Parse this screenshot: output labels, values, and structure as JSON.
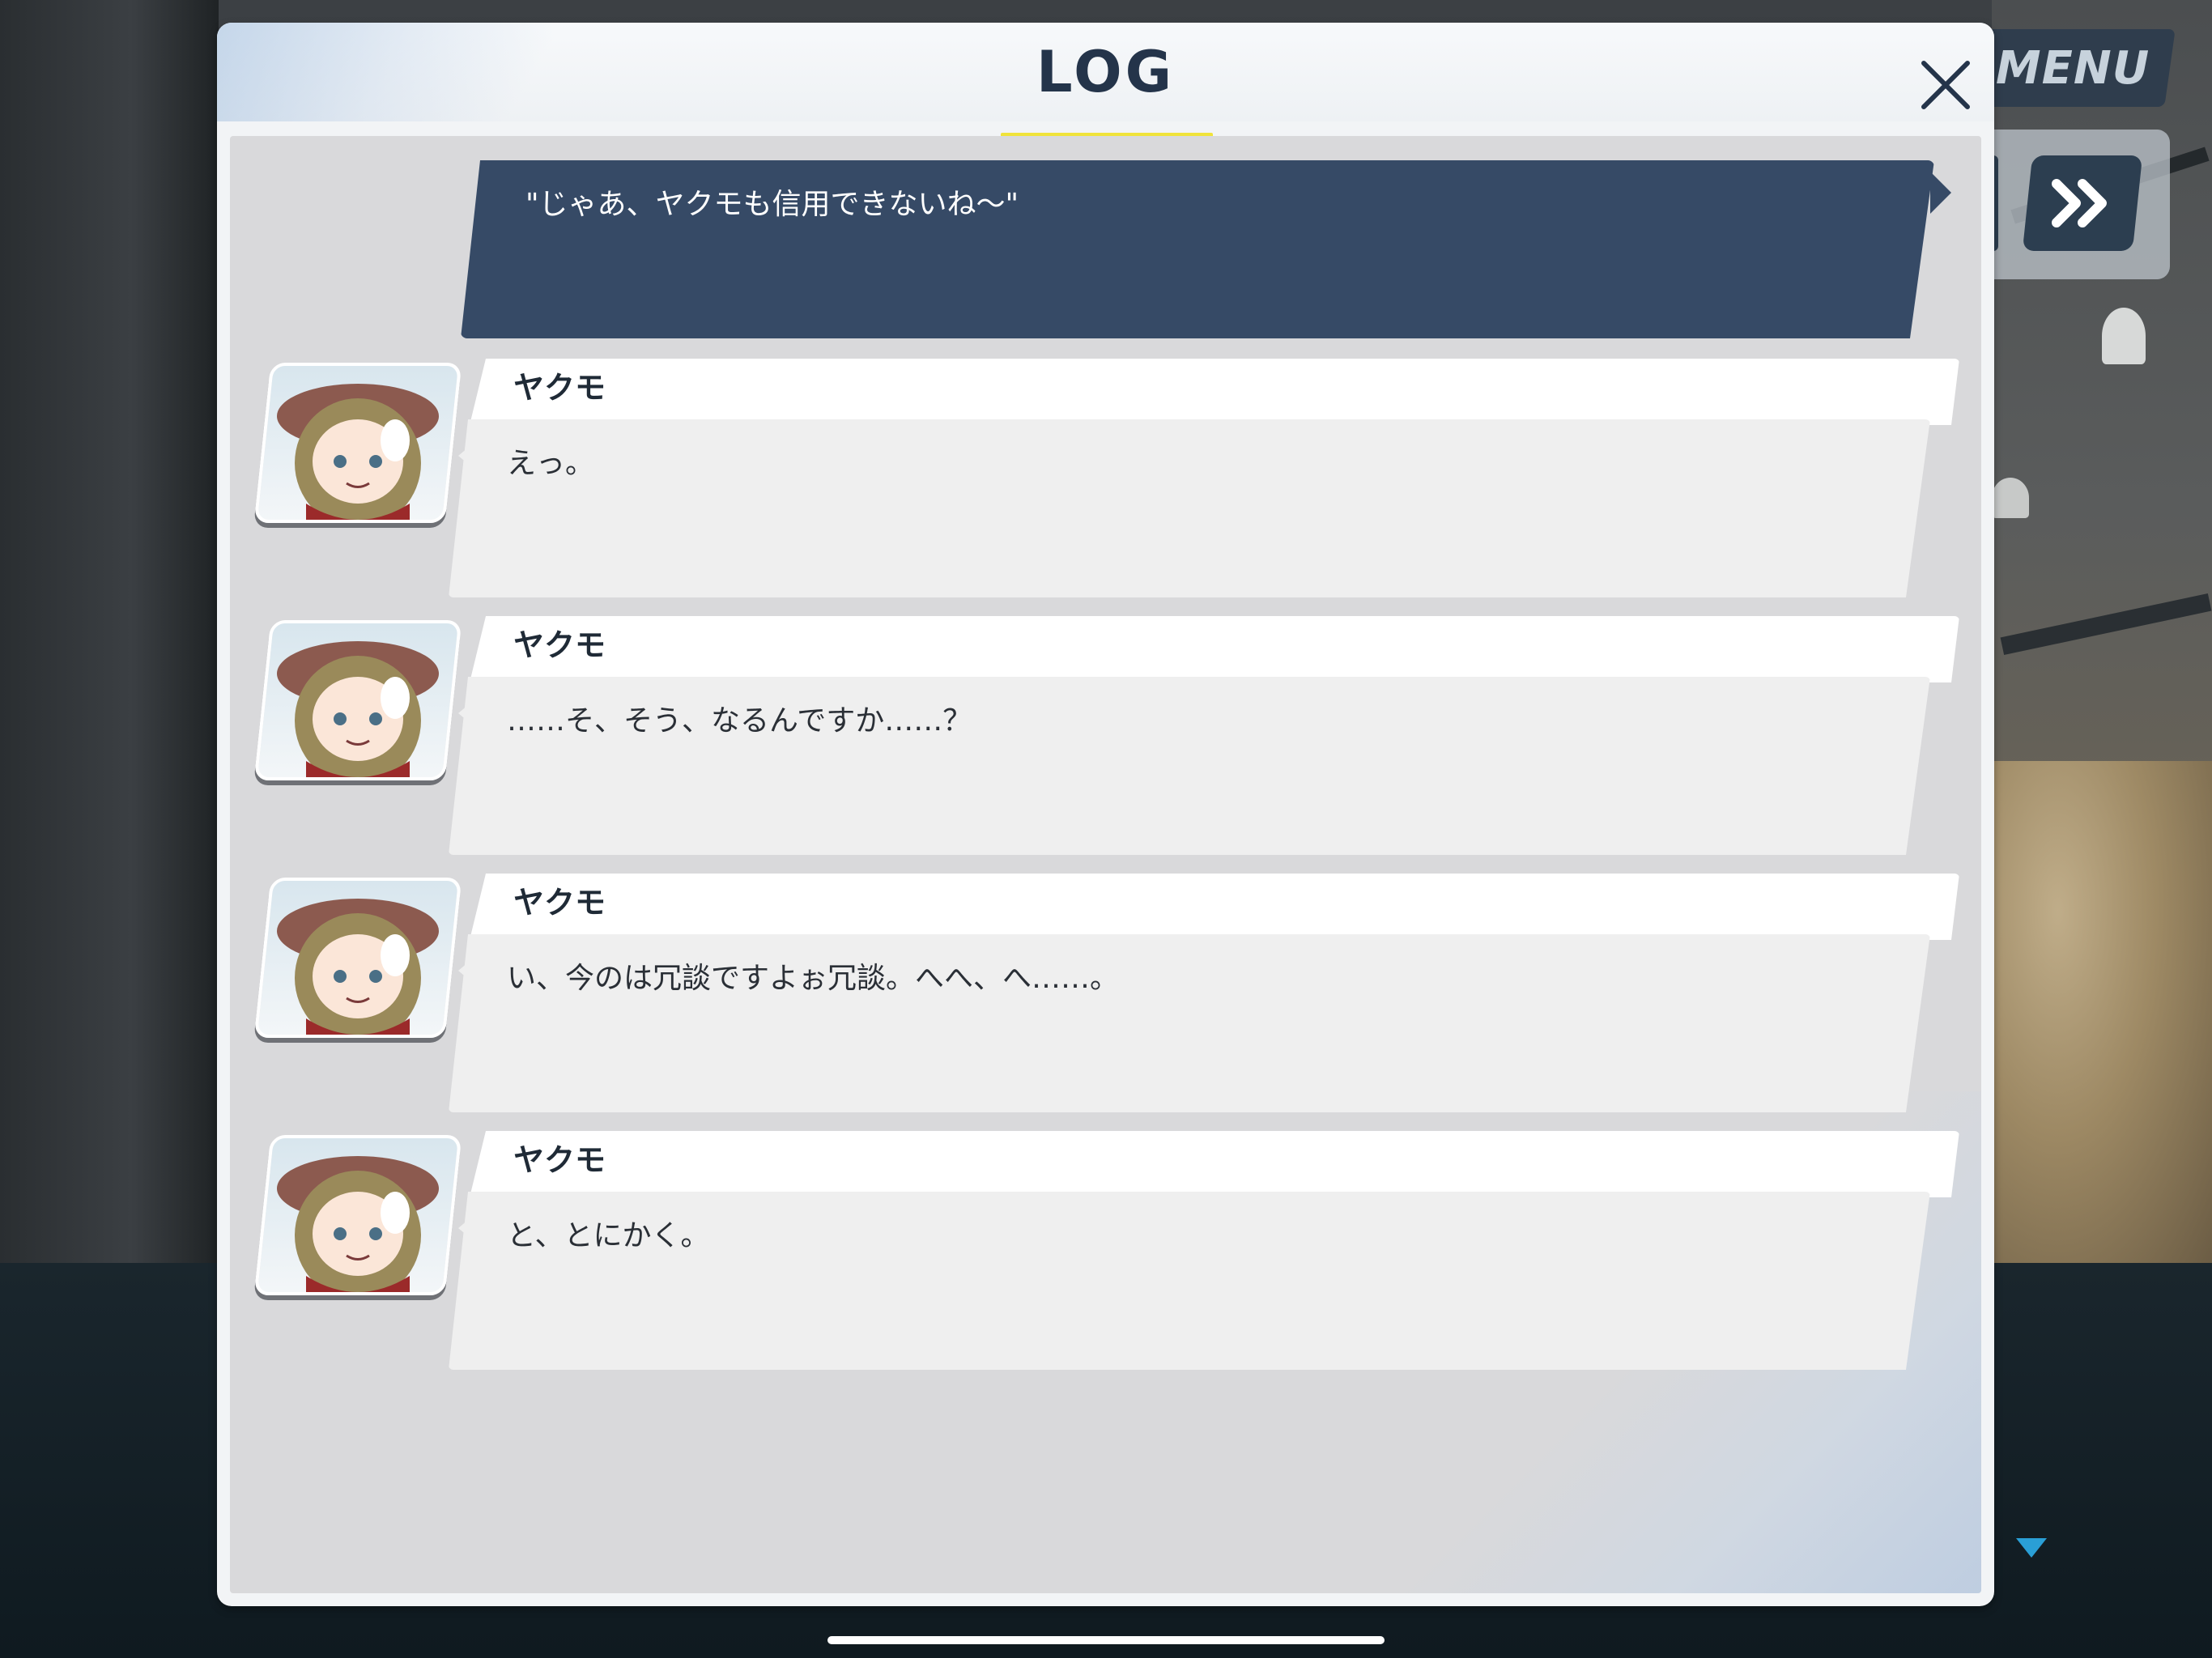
{
  "hud": {
    "menu_label": "MENU"
  },
  "log": {
    "title": "LOG",
    "narration": "\"じゃあ、ヤクモも信用できないね～\"",
    "entries": [
      {
        "speaker": "ヤクモ",
        "text": "えっ。"
      },
      {
        "speaker": "ヤクモ",
        "text": "……そ、そう、なるんですか……？"
      },
      {
        "speaker": "ヤクモ",
        "text": "い、今のは冗談ですよぉ冗談。へへ、へ……。"
      },
      {
        "speaker": "ヤクモ",
        "text": "と、とにかく。"
      }
    ]
  },
  "colors": {
    "panel_bg": "#f2f4f6",
    "body_bg": "#d9d9db",
    "narration_bg": "#364a66",
    "title_underline": "#f0e33a",
    "menu_bg": "#2f3d4d",
    "scroll_indicator": "#2a9fd6"
  },
  "icons": {
    "close": "close-icon",
    "skip": "fast-forward-icon",
    "scroll": "triangle-down-icon"
  }
}
